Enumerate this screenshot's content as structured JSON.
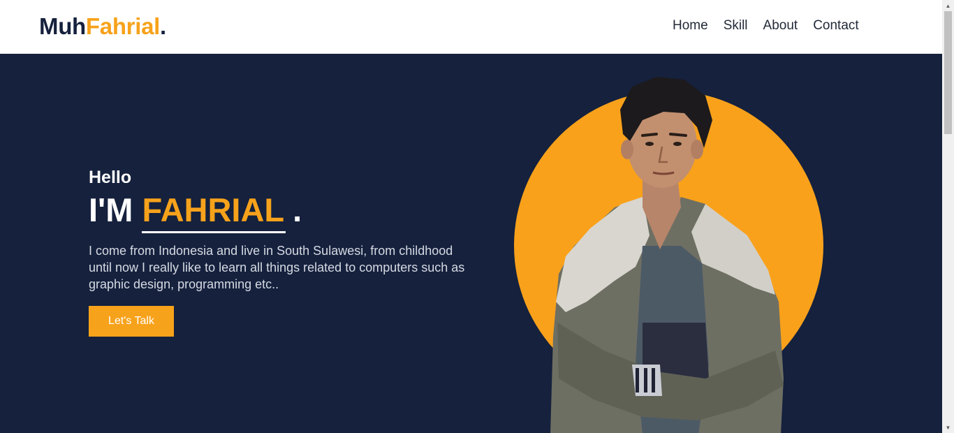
{
  "header": {
    "logo": {
      "part1": "Muh",
      "part2": "Fahrial",
      "part3": "."
    },
    "nav": [
      {
        "label": "Home"
      },
      {
        "label": "Skill"
      },
      {
        "label": "About"
      },
      {
        "label": "Contact"
      }
    ]
  },
  "hero": {
    "greeting": "Hello",
    "headline_prefix": "I'M",
    "headline_name": "FAHRIAL",
    "headline_suffix": ".",
    "description": "I come from Indonesia and live in South Sulawesi, from childhood until now I really like to learn all things related to computers such as graphic design, programming etc..",
    "cta_label": "Let's Talk"
  },
  "colors": {
    "accent": "#f7a21b",
    "hero_bg": "#15213d",
    "header_bg": "#ffffff"
  },
  "icons": {
    "portrait": "person-photo",
    "scroll_up": "triangle-up",
    "scroll_down": "triangle-down"
  }
}
